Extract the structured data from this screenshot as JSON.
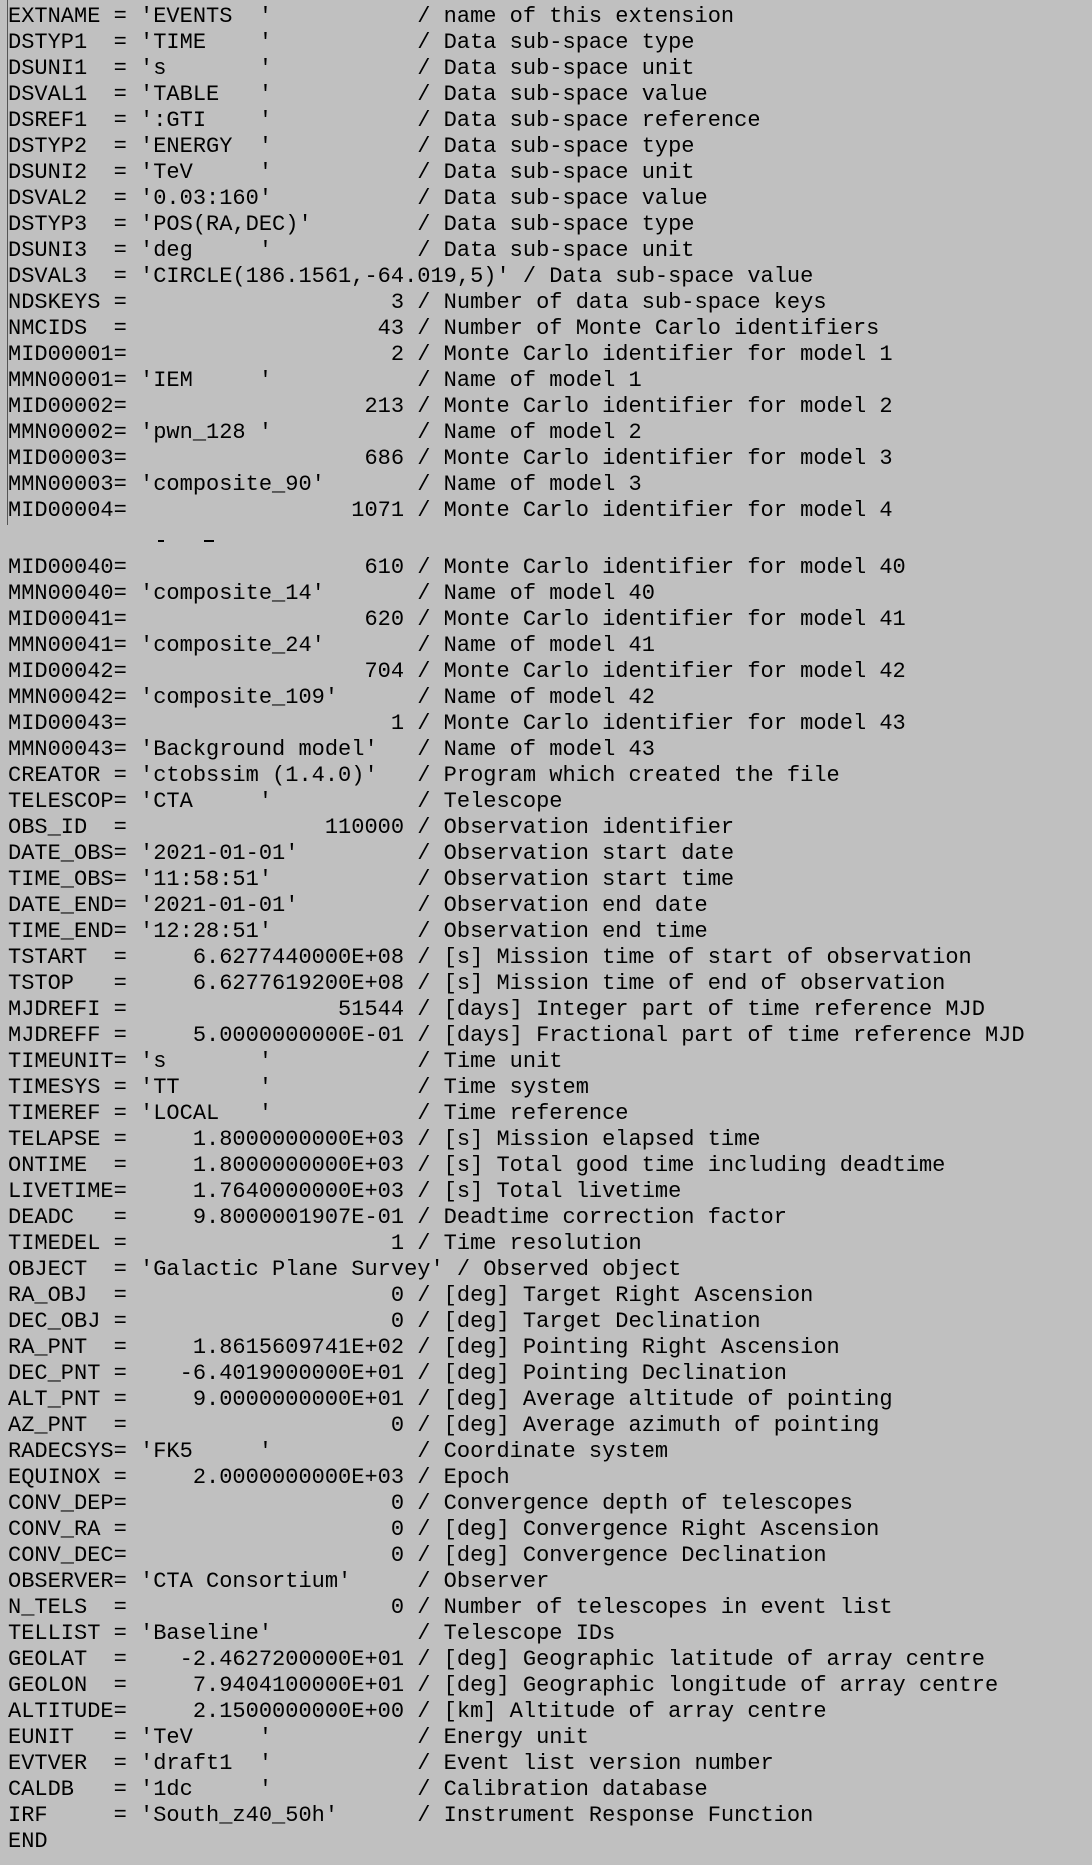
{
  "header_top": [
    "EXTNAME = 'EVENTS  '           / name of this extension",
    "DSTYP1  = 'TIME    '           / Data sub-space type",
    "DSUNI1  = 's       '           / Data sub-space unit",
    "DSVAL1  = 'TABLE   '           / Data sub-space value",
    "DSREF1  = ':GTI    '           / Data sub-space reference",
    "DSTYP2  = 'ENERGY  '           / Data sub-space type",
    "DSUNI2  = 'TeV     '           / Data sub-space unit",
    "DSVAL2  = '0.03:160'           / Data sub-space value",
    "DSTYP3  = 'POS(RA,DEC)'        / Data sub-space type",
    "DSUNI3  = 'deg     '           / Data sub-space unit",
    "DSVAL3  = 'CIRCLE(186.1561,-64.019,5)' / Data sub-space value",
    "NDSKEYS =                    3 / Number of data sub-space keys",
    "NMCIDS  =                   43 / Number of Monte Carlo identifiers",
    "MID00001=                    2 / Monte Carlo identifier for model 1",
    "MMN00001= 'IEM     '           / Name of model 1",
    "MID00002=                  213 / Monte Carlo identifier for model 2",
    "MMN00002= 'pwn_128 '           / Name of model 2",
    "MID00003=                  686 / Monte Carlo identifier for model 3",
    "MMN00003= 'composite_90'       / Name of model 3",
    "MID00004=                 1071 / Monte Carlo identifier for model 4"
  ],
  "header_bottom": [
    "MID00040=                  610 / Monte Carlo identifier for model 40",
    "MMN00040= 'composite_14'       / Name of model 40",
    "MID00041=                  620 / Monte Carlo identifier for model 41",
    "MMN00041= 'composite_24'       / Name of model 41",
    "MID00042=                  704 / Monte Carlo identifier for model 42",
    "MMN00042= 'composite_109'      / Name of model 42",
    "MID00043=                    1 / Monte Carlo identifier for model 43",
    "MMN00043= 'Background model'   / Name of model 43",
    "CREATOR = 'ctobssim (1.4.0)'   / Program which created the file",
    "TELESCOP= 'CTA     '           / Telescope",
    "OBS_ID  =               110000 / Observation identifier",
    "DATE_OBS= '2021-01-01'         / Observation start date",
    "TIME_OBS= '11:58:51'           / Observation start time",
    "DATE_END= '2021-01-01'         / Observation end date",
    "TIME_END= '12:28:51'           / Observation end time",
    "TSTART  =     6.6277440000E+08 / [s] Mission time of start of observation",
    "TSTOP   =     6.6277619200E+08 / [s] Mission time of end of observation",
    "MJDREFI =                51544 / [days] Integer part of time reference MJD",
    "MJDREFF =     5.0000000000E-01 / [days] Fractional part of time reference MJD",
    "TIMEUNIT= 's       '           / Time unit",
    "TIMESYS = 'TT      '           / Time system",
    "TIMEREF = 'LOCAL   '           / Time reference",
    "TELAPSE =     1.8000000000E+03 / [s] Mission elapsed time",
    "ONTIME  =     1.8000000000E+03 / [s] Total good time including deadtime",
    "LIVETIME=     1.7640000000E+03 / [s] Total livetime",
    "DEADC   =     9.8000001907E-01 / Deadtime correction factor",
    "TIMEDEL =                    1 / Time resolution",
    "OBJECT  = 'Galactic Plane Survey' / Observed object",
    "RA_OBJ  =                    0 / [deg] Target Right Ascension",
    "DEC_OBJ =                    0 / [deg] Target Declination",
    "RA_PNT  =     1.8615609741E+02 / [deg] Pointing Right Ascension",
    "DEC_PNT =    -6.4019000000E+01 / [deg] Pointing Declination",
    "ALT_PNT =     9.0000000000E+01 / [deg] Average altitude of pointing",
    "AZ_PNT  =                    0 / [deg] Average azimuth of pointing",
    "RADECSYS= 'FK5     '           / Coordinate system",
    "EQUINOX =     2.0000000000E+03 / Epoch",
    "CONV_DEP=                    0 / Convergence depth of telescopes",
    "CONV_RA =                    0 / [deg] Convergence Right Ascension",
    "CONV_DEC=                    0 / [deg] Convergence Declination",
    "OBSERVER= 'CTA Consortium'     / Observer",
    "N_TELS  =                    0 / Number of telescopes in event list",
    "TELLIST = 'Baseline'           / Telescope IDs",
    "GEOLAT  =    -2.4627200000E+01 / [deg] Geographic latitude of array centre",
    "GEOLON  =     7.9404100000E+01 / [deg] Geographic longitude of array centre",
    "ALTITUDE=     2.1500000000E+00 / [km] Altitude of array centre",
    "EUNIT   = 'TeV     '           / Energy unit",
    "EVTVER  = 'draft1  '           / Event list version number",
    "CALDB   = '1dc     '           / Calibration database",
    "IRF     = 'South_z40_50h'      / Instrument Response Function",
    "END"
  ]
}
